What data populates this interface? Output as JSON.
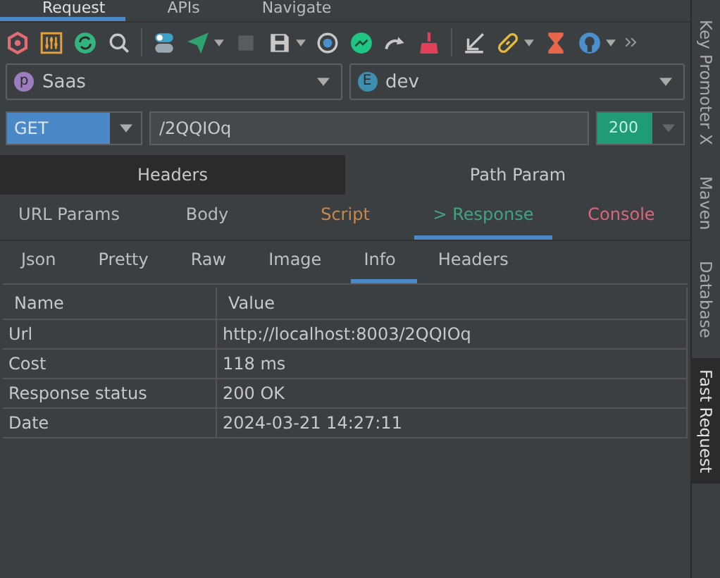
{
  "top_tabs": [
    {
      "label": "Request",
      "selected": true
    },
    {
      "label": "APIs",
      "selected": false
    },
    {
      "label": "Navigate",
      "selected": false
    }
  ],
  "project": {
    "badge": "p",
    "value": "Saas"
  },
  "environment": {
    "badge": "E",
    "value": "dev"
  },
  "request": {
    "method": "GET",
    "url": "/2QQIOq",
    "status": "200"
  },
  "param_tabs": [
    {
      "label": "Headers",
      "selected": true
    },
    {
      "label": "Path Param",
      "selected": false
    }
  ],
  "section_tabs": [
    {
      "label": "URL Params",
      "selected": false,
      "color": "#bbbbbb"
    },
    {
      "label": "Body",
      "selected": false,
      "color": "#bbbbbb"
    },
    {
      "label": "Script",
      "selected": false,
      "color": "#c7894a"
    },
    {
      "label": "> Response",
      "selected": true,
      "color": "#3fa47f"
    },
    {
      "label": "Console",
      "selected": false,
      "color": "#d8677c"
    }
  ],
  "response_tabs": [
    {
      "label": "Json",
      "selected": false
    },
    {
      "label": "Pretty",
      "selected": false
    },
    {
      "label": "Raw",
      "selected": false
    },
    {
      "label": "Image",
      "selected": false
    },
    {
      "label": "Info",
      "selected": true
    },
    {
      "label": "Headers",
      "selected": false
    }
  ],
  "table": {
    "columns": [
      "Name",
      "Value"
    ],
    "rows": [
      [
        "Url",
        "http://localhost:8003/2QQIOq"
      ],
      [
        "Cost",
        "118 ms"
      ],
      [
        "Response status",
        "200 OK"
      ],
      [
        "Date",
        "2024-03-21 14:27:11"
      ]
    ]
  },
  "side_tools": [
    {
      "label": "Key Promoter X",
      "selected": false
    },
    {
      "label": "Maven",
      "selected": false
    },
    {
      "label": "Database",
      "selected": false
    },
    {
      "label": "Fast Request",
      "selected": true
    }
  ]
}
